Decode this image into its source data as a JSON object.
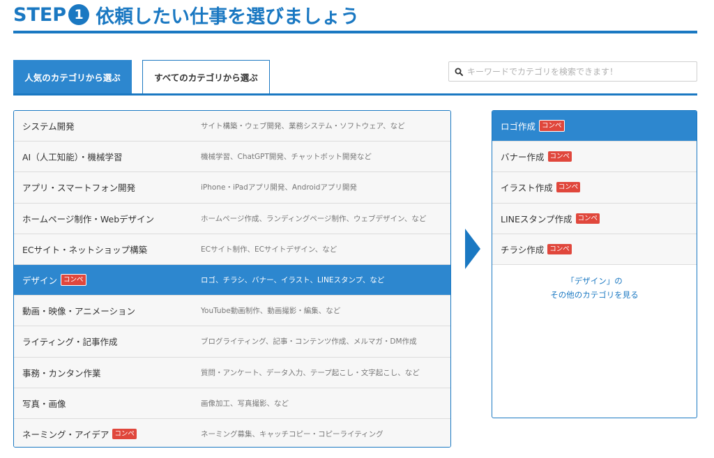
{
  "header": {
    "step_label": "STEP",
    "step_number": "1",
    "title": "依頼したい仕事を選びましょう"
  },
  "tabs": [
    {
      "label": "人気のカテゴリから選ぶ",
      "active": true
    },
    {
      "label": "すべてのカテゴリから選ぶ",
      "active": false
    }
  ],
  "search": {
    "placeholder": "キーワードでカテゴリを検索できます！"
  },
  "badge_label": "コンペ",
  "categories": [
    {
      "name": "システム開発",
      "desc": "サイト構築・ウェブ開発、業務システム・ソフトウェア、など"
    },
    {
      "name": "AI（人工知能）・機械学習",
      "desc": "機械学習、ChatGPT開発、チャットボット開発など"
    },
    {
      "name": "アプリ・スマートフォン開発",
      "desc": "iPhone・iPadアプリ開発、Androidアプリ開発"
    },
    {
      "name": "ホームページ制作・Webデザイン",
      "desc": "ホームページ作成、ランディングページ制作、ウェブデザイン、など"
    },
    {
      "name": "ECサイト・ネットショップ構築",
      "desc": "ECサイト制作、ECサイトデザイン、など"
    },
    {
      "name": "デザイン",
      "desc": "ロゴ、チラシ、バナー、イラスト、LINEスタンプ、など"
    },
    {
      "name": "動画・映像・アニメーション",
      "desc": "YouTube動画制作、動画撮影・編集、など"
    },
    {
      "name": "ライティング・記事作成",
      "desc": "ブログライティング、記事・コンテンツ作成、メルマガ・DM作成"
    },
    {
      "name": "事務・カンタン作業",
      "desc": "質問・アンケート、データ入力、テープ起こし・文字起こし、など"
    },
    {
      "name": "写真・画像",
      "desc": "画像加工、写真撮影、など"
    },
    {
      "name": "ネーミング・アイデア",
      "desc": "ネーミング募集、キャッチコピー・コピーライティング"
    }
  ],
  "subcategories": [
    {
      "name": "ロゴ作成"
    },
    {
      "name": "バナー作成"
    },
    {
      "name": "イラスト作成"
    },
    {
      "name": "LINEスタンプ作成"
    },
    {
      "name": "チラシ作成"
    }
  ],
  "more_link": {
    "line1": "「デザイン」の",
    "line2": "その他のカテゴリを見る"
  },
  "colors": {
    "brand_blue": "#1a78c2",
    "selected_blue": "#2d87cf",
    "badge_red": "#e0473c"
  },
  "icons": {
    "search": "search-icon",
    "arrow": "arrow-right-icon"
  }
}
